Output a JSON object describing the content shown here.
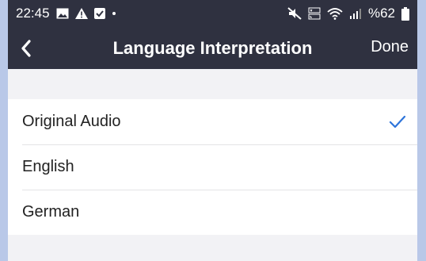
{
  "status_bar": {
    "time": "22:45",
    "battery": "%62",
    "left_icons": [
      "image-icon",
      "warning-icon",
      "checkbox-icon",
      "dot-icon"
    ],
    "right_icons": [
      "mute-icon",
      "volte-icon",
      "wifi-icon",
      "signal-icon",
      "battery-icon"
    ]
  },
  "nav": {
    "title": "Language Interpretation",
    "done_label": "Done"
  },
  "options": [
    {
      "label": "Original Audio",
      "selected": true
    },
    {
      "label": "English",
      "selected": false
    },
    {
      "label": "German",
      "selected": false
    }
  ],
  "colors": {
    "header_bg": "#2f3140",
    "page_bg": "#f2f2f5",
    "check_color": "#2d74da",
    "outer_bg": "#b9c8e8"
  }
}
